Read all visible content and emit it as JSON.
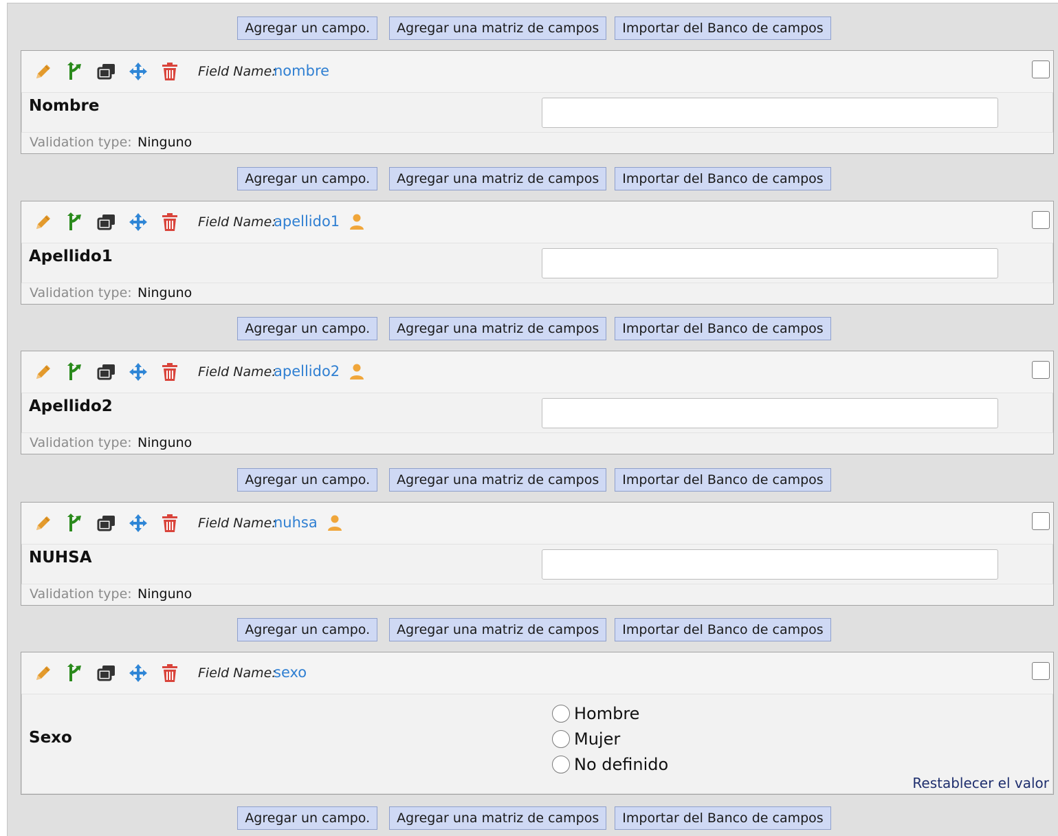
{
  "buttons": {
    "add_field": "Agregar un campo.",
    "add_matrix": "Agregar una matriz de campos",
    "import_bank": "Importar del Banco de campos"
  },
  "labels": {
    "field_name": "Field Name:",
    "validation_type": "Validation type:",
    "reset_value": "Restablecer el valor"
  },
  "fields": [
    {
      "var": "nombre",
      "label": "Nombre",
      "validation": "Ninguno",
      "identifier": false
    },
    {
      "var": "apellido1",
      "label": "Apellido1",
      "validation": "Ninguno",
      "identifier": true
    },
    {
      "var": "apellido2",
      "label": "Apellido2",
      "validation": "Ninguno",
      "identifier": true
    },
    {
      "var": "nuhsa",
      "label": "NUHSA",
      "validation": "Ninguno",
      "identifier": true
    },
    {
      "var": "sexo",
      "label": "Sexo",
      "type": "radio",
      "options": [
        "Hombre",
        "Mujer",
        "No definido"
      ],
      "identifier": false
    }
  ],
  "colors": {
    "edit_icon": "#e39a2c",
    "branch_icon": "#2a8a1c",
    "copy_icon": "#333333",
    "move_icon": "#2f86d6",
    "delete_icon": "#d9443b",
    "identifier_icon": "#f0a63a",
    "field_name_link": "#2f7fd2",
    "button_bg": "#cfd9f4"
  }
}
